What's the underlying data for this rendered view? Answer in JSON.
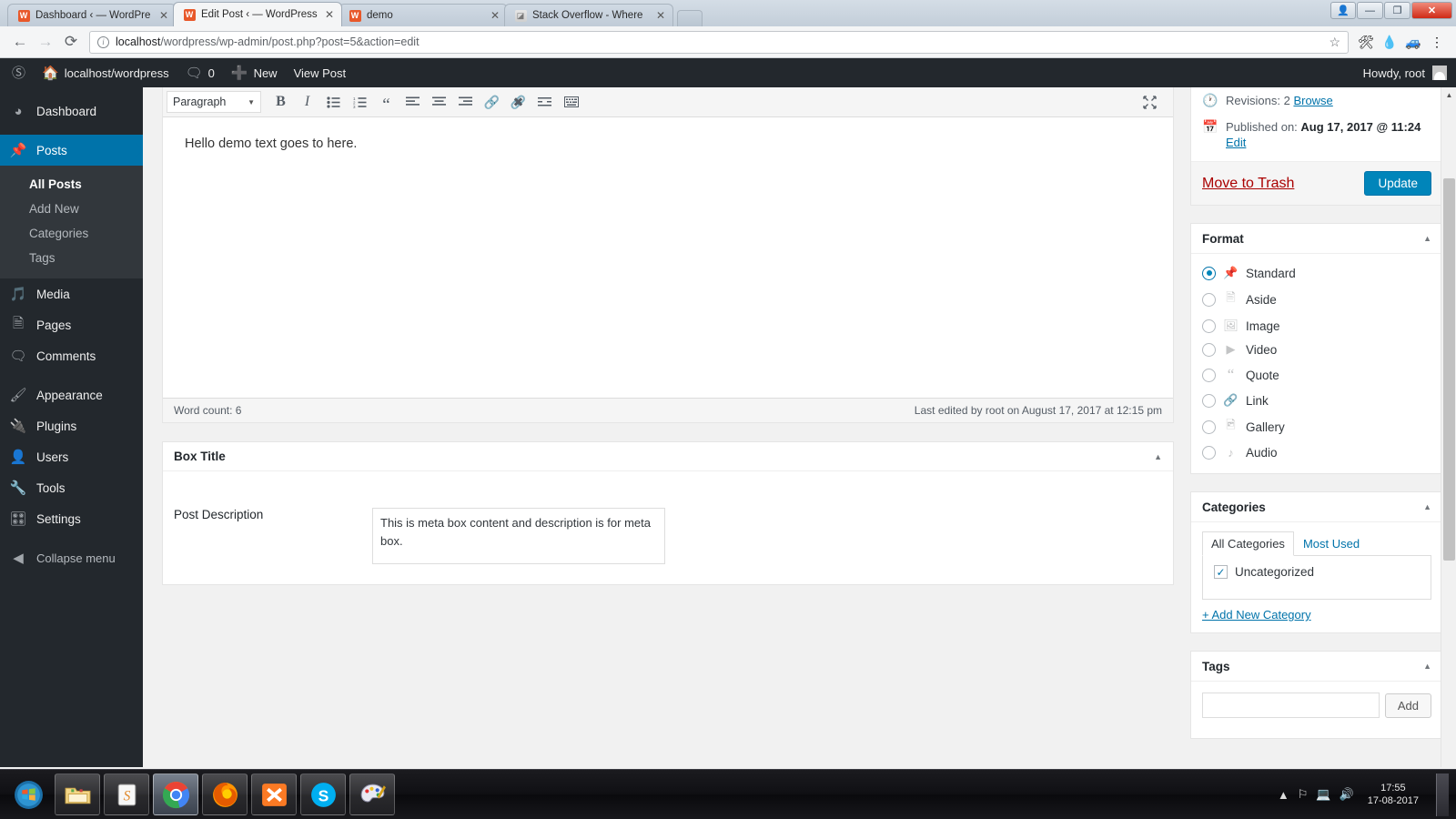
{
  "browser": {
    "tabs": [
      {
        "title": "Dashboard ‹ — WordPre",
        "favicon": "wordpress-favicon",
        "active": false
      },
      {
        "title": "Edit Post ‹ — WordPress",
        "favicon": "wordpress-favicon",
        "active": true
      },
      {
        "title": "demo",
        "favicon": "wordpress-favicon",
        "active": false
      },
      {
        "title": "Stack Overflow - Where",
        "favicon": "stackoverflow-favicon",
        "active": false
      }
    ],
    "url_host": "localhost",
    "url_path": "/wordpress/wp-admin/post.php?post=5&action=edit",
    "close_label": "✕",
    "minimize_label": "—",
    "maximize_label": "❐",
    "new_tab_label": ""
  },
  "adminbar": {
    "site_name": "localhost/wordpress",
    "comments_count": "0",
    "new_label": "New",
    "view_post_label": "View Post",
    "howdy": "Howdy, root"
  },
  "sidebar": {
    "items": [
      {
        "label": "Dashboard",
        "icon": "dashboard-icon",
        "current": false
      },
      {
        "label": "Posts",
        "icon": "pin-icon",
        "current": true
      },
      {
        "label": "Media",
        "icon": "media-icon",
        "current": false
      },
      {
        "label": "Pages",
        "icon": "pages-icon",
        "current": false
      },
      {
        "label": "Comments",
        "icon": "comments-icon",
        "current": false
      },
      {
        "label": "Appearance",
        "icon": "appearance-icon",
        "current": false
      },
      {
        "label": "Plugins",
        "icon": "plugins-icon",
        "current": false
      },
      {
        "label": "Users",
        "icon": "users-icon",
        "current": false
      },
      {
        "label": "Tools",
        "icon": "tools-icon",
        "current": false
      },
      {
        "label": "Settings",
        "icon": "settings-icon",
        "current": false
      }
    ],
    "submenu": [
      {
        "label": "All Posts",
        "current": true
      },
      {
        "label": "Add New",
        "current": false
      },
      {
        "label": "Categories",
        "current": false
      },
      {
        "label": "Tags",
        "current": false
      }
    ],
    "collapse_label": "Collapse menu"
  },
  "editor": {
    "paragraph_select": "Paragraph",
    "toolbar_buttons": [
      "bold-icon",
      "italic-icon",
      "bulleted-list-icon",
      "numbered-list-icon",
      "blockquote-icon",
      "align-left-icon",
      "align-center-icon",
      "align-right-icon",
      "insert-link-icon",
      "unlink-icon",
      "read-more-icon",
      "toolbar-toggle-icon"
    ],
    "content": "Hello demo text goes to here.",
    "word_count": "Word count: 6",
    "last_edited": "Last edited by root on August 17, 2017 at 12:15 pm"
  },
  "metabox": {
    "title": "Box Title",
    "field_label": "Post Description",
    "field_value": "This is meta box content and description is for meta box."
  },
  "publish": {
    "revisions_label": "Revisions: 2",
    "revisions_link": "Browse",
    "published_label": "Published on:",
    "published_date": "Aug 17, 2017 @ 11:24",
    "edit_link": "Edit",
    "trash_link": "Move to Trash",
    "update_label": "Update"
  },
  "format": {
    "title": "Format",
    "options": [
      {
        "label": "Standard",
        "icon": "pin-icon",
        "selected": true
      },
      {
        "label": "Aside",
        "icon": "aside-icon",
        "selected": false
      },
      {
        "label": "Image",
        "icon": "image-icon",
        "selected": false
      },
      {
        "label": "Video",
        "icon": "video-icon",
        "selected": false
      },
      {
        "label": "Quote",
        "icon": "quote-icon",
        "selected": false
      },
      {
        "label": "Link",
        "icon": "link-icon",
        "selected": false
      },
      {
        "label": "Gallery",
        "icon": "gallery-icon",
        "selected": false
      },
      {
        "label": "Audio",
        "icon": "audio-icon",
        "selected": false
      }
    ]
  },
  "categories": {
    "title": "Categories",
    "tabs": [
      {
        "label": "All Categories",
        "active": true
      },
      {
        "label": "Most Used",
        "active": false
      }
    ],
    "items": [
      {
        "label": "Uncategorized",
        "checked": true
      }
    ],
    "add_new_link": "+ Add New Category"
  },
  "tags": {
    "title": "Tags",
    "input_value": "",
    "add_label": "Add"
  },
  "taskbar": {
    "apps": [
      {
        "name": "start-button",
        "state": "start"
      },
      {
        "name": "file-explorer",
        "state": "running"
      },
      {
        "name": "sublime-text",
        "state": "running"
      },
      {
        "name": "google-chrome",
        "state": "active"
      },
      {
        "name": "mozilla-firefox",
        "state": "running"
      },
      {
        "name": "xampp",
        "state": "running"
      },
      {
        "name": "skype",
        "state": "running"
      },
      {
        "name": "paint",
        "state": "running"
      }
    ],
    "time": "17:55",
    "date": "17-08-2017"
  },
  "colors": {
    "wp_blue": "#0085ba",
    "wp_dark": "#23282d",
    "wp_menu_current": "#0073aa",
    "link": "#0073aa",
    "delete": "#a00000"
  }
}
